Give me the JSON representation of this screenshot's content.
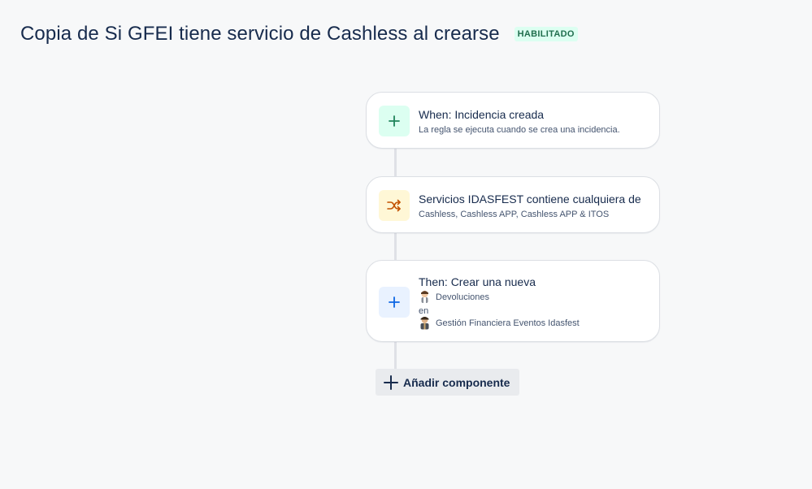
{
  "header": {
    "title": "Copia de Si GFEI tiene servicio de Cashless al crearse",
    "status": "HABILITADO"
  },
  "components": [
    {
      "title": "When: Incidencia creada",
      "subtitle": "La regla se ejecuta cuando se crea una incidencia.",
      "icon": "plus-icon",
      "icon_bg": "#dcfff1",
      "icon_color": "#1f845a"
    },
    {
      "title": "Servicios IDASFEST contiene cualquiera de",
      "subtitle": "Cashless, Cashless APP, Cashless APP & ITOS",
      "icon": "shuffle-icon",
      "icon_bg": "#fff7d6",
      "icon_color": "#c25100"
    },
    {
      "title": "Then: Crear una nueva",
      "icon": "plus-icon",
      "icon_bg": "#e9f2ff",
      "icon_color": "#0c66e4",
      "issue_type": "Devoluciones",
      "connector_word": "en",
      "project": "Gestión Financiera Eventos Idasfest"
    }
  ],
  "add_component_label": "Añadir componente"
}
